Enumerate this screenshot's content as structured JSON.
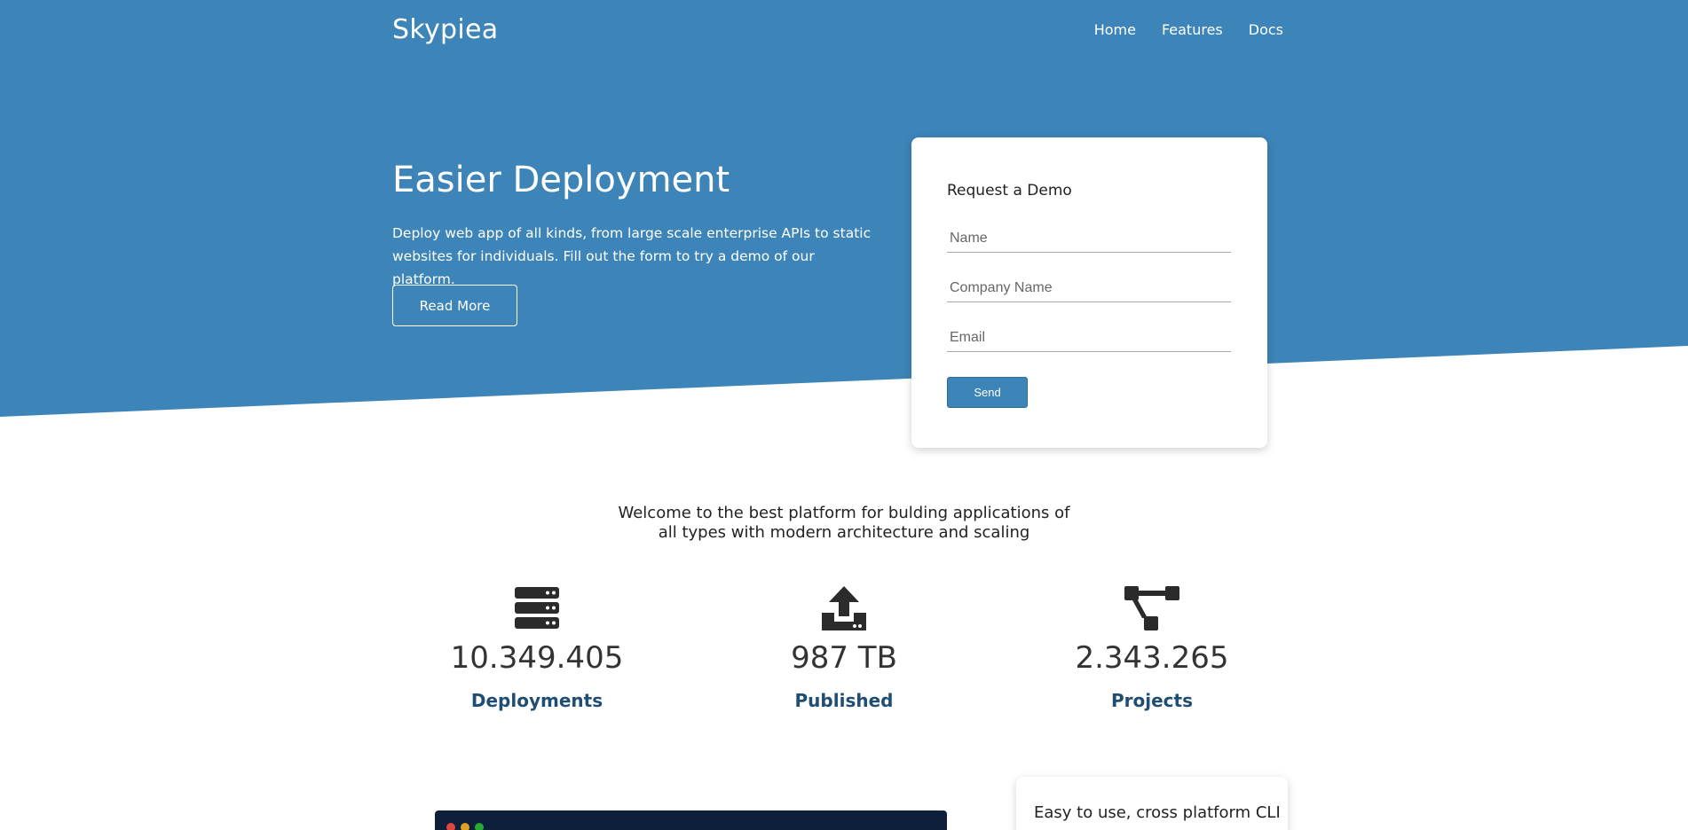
{
  "colors": {
    "hero_bg": "#3d84b8",
    "accent": "#3d84b8",
    "stat_label": "#1f4d73",
    "terminal_bg": "#0e1f3a"
  },
  "nav": {
    "logo": "Skypiea",
    "links": [
      {
        "label": "Home"
      },
      {
        "label": "Features"
      },
      {
        "label": "Docs"
      }
    ]
  },
  "hero": {
    "title": "Easier Deployment",
    "text": "Deploy web app of all kinds, from large scale enterprise APIs to static websites for individuals. Fill out the form to try a demo of our platform.",
    "read_more_label": "Read More"
  },
  "demo_form": {
    "title": "Request a Demo",
    "name_placeholder": "Name",
    "company_placeholder": "Company Name",
    "email_placeholder": "Email",
    "send_label": "Send"
  },
  "welcome": {
    "line1": "Welcome to the best platform for bulding applications of",
    "line2": "all types with modern architecture and scaling"
  },
  "stats": [
    {
      "icon": "server-icon",
      "value": "10.349.405",
      "label": "Deployments"
    },
    {
      "icon": "upload-icon",
      "value": "987 TB",
      "label": "Published"
    },
    {
      "icon": "project-diagram-icon",
      "value": "2.343.265",
      "label": "Projects"
    }
  ],
  "cli_card": {
    "title": "Easy to use, cross platform CLI"
  }
}
